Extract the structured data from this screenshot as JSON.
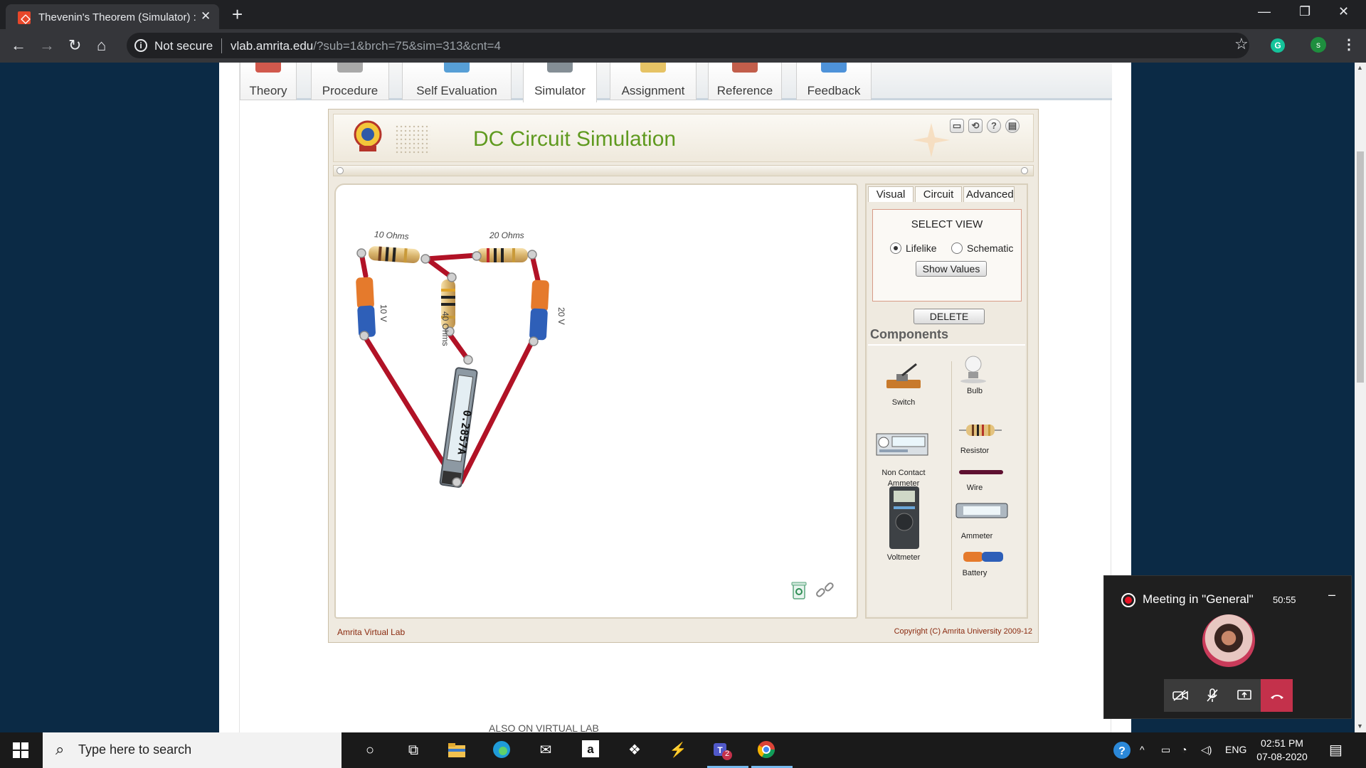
{
  "browser": {
    "tab_title": "Thevenin's Theorem (Simulator) : ",
    "tab_close": "✕",
    "new_tab": "+",
    "security_label": "Not secure",
    "url_host": "vlab.amrita.edu",
    "url_path": "/?sub=1&brch=75&sim=313&cnt=4",
    "profile_initial": "s",
    "grammarly_initial": "G"
  },
  "site_tabs": [
    {
      "label": "Theory",
      "icon_color": "#c93c2e"
    },
    {
      "label": "Procedure",
      "icon_color": "#9a9a9a"
    },
    {
      "label": "Self Evaluation",
      "icon_color": "#3a8ecf"
    },
    {
      "label": "Simulator",
      "icon_color": "#6f7a83"
    },
    {
      "label": "Assignment",
      "icon_color": "#e2b94a"
    },
    {
      "label": "Reference",
      "icon_color": "#b7422c"
    },
    {
      "label": "Feedback",
      "icon_color": "#2f7fd2"
    }
  ],
  "sim": {
    "title": "DC Circuit Simulation",
    "footer_left": "Amrita Virtual Lab",
    "footer_right": "Copyright (C) Amrita University 2009-12",
    "labels": {
      "r1": "10 Ohms",
      "r2": "20 Ohms",
      "r3": "40 Ohms",
      "v1": "10 V",
      "v2": "20 V",
      "ammeter_reading": "0.2857A"
    },
    "side_tabs": [
      "Visual",
      "Circuit",
      "Advanced"
    ],
    "select_view_title": "SELECT VIEW",
    "view_options": [
      "Lifelike",
      "Schematic"
    ],
    "selected_view": "Lifelike",
    "show_values": "Show Values",
    "delete": "DELETE",
    "components_title": "Components",
    "components": {
      "switch": "Switch",
      "bulb": "Bulb",
      "resistor": "Resistor",
      "non_contact_ammeter": "Non Contact Ammeter",
      "wire": "Wire",
      "ammeter": "Ammeter",
      "voltmeter": "Voltmeter",
      "battery": "Battery"
    }
  },
  "also_on": "ALSO ON VIRTUAL LAB",
  "meeting": {
    "title": "Meeting in \"General\"",
    "elapsed": "50:55",
    "minimize": "–"
  },
  "taskbar": {
    "search_placeholder": "Type here to search",
    "lang": "ENG",
    "time": "02:51 PM",
    "date": "07-08-2020",
    "teams_badge": "2"
  }
}
